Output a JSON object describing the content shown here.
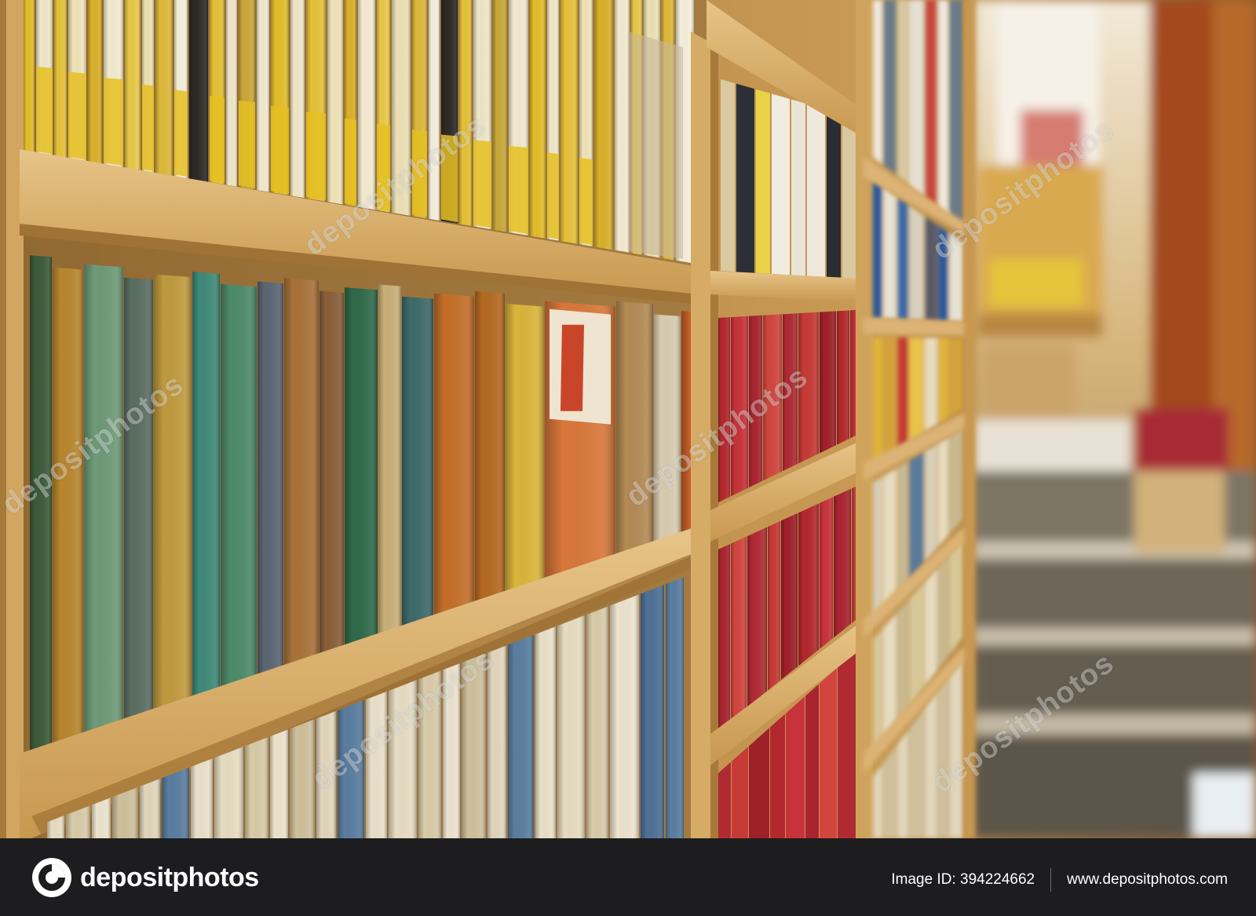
{
  "photo": {
    "subject": "bookshelf-photo",
    "watermark_text": "depositphotos"
  },
  "footer": {
    "logo_text": "depositphotos",
    "image_id": "Image ID: 394224662",
    "site_url": "www.depositphotos.com"
  },
  "colors": {
    "footer_bg": "#1d1d1f",
    "shelf_wood": "#d9b06a",
    "accent_red": "#b3282d",
    "accent_yellow": "#e0bb1e"
  }
}
